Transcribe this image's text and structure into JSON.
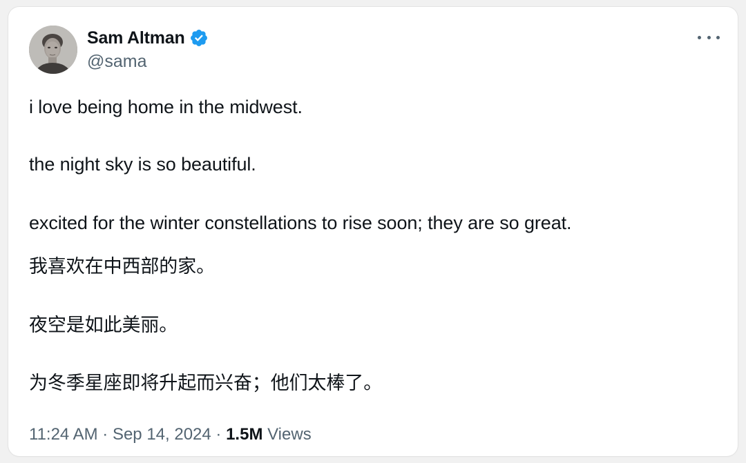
{
  "author": {
    "display_name": "Sam Altman",
    "handle": "@sama",
    "verified": true,
    "verified_color": "#1d9bf0"
  },
  "icons": {
    "verified": "verified-badge-icon",
    "more": "more-options-icon"
  },
  "tweet": {
    "lines": [
      "i love being home in the midwest.",
      "the night sky is so beautiful.",
      "excited for the winter constellations to rise soon; they are so great.",
      "我喜欢在中西部的家。",
      "夜空是如此美丽。",
      "为冬季星座即将升起而兴奋；他们太棒了。"
    ]
  },
  "meta": {
    "time": "11:24 AM",
    "separator": " · ",
    "date": "Sep 14, 2024",
    "views_count": "1.5M",
    "views_label": "Views"
  },
  "colors": {
    "text_primary": "#0f1419",
    "text_secondary": "#536471",
    "background": "#ffffff"
  }
}
